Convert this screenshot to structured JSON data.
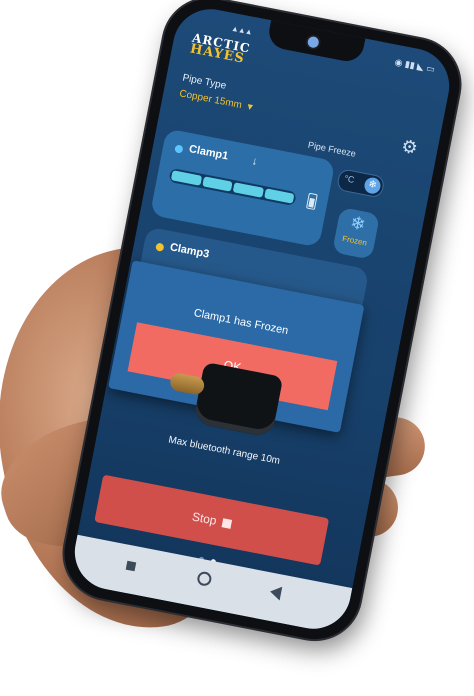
{
  "app": {
    "logo_line1": "ARCTIC",
    "logo_line2": "HAYES"
  },
  "header": {
    "pipe_type_label": "Pipe Type",
    "pipe_type_value": "Copper 15mm",
    "pipe_freeze_label": "Pipe Freeze",
    "unit_label": "°C",
    "settings_icon": "gear-icon"
  },
  "clamps": [
    {
      "name": "Clamp1",
      "indicator_color": "#5ec5ff",
      "progress_segments_filled": 4,
      "progress_segments_total": 4
    },
    {
      "name": "Clamp3",
      "indicator_color": "#f2c233"
    }
  ],
  "frozen_badge": {
    "label": "Frozen",
    "icon": "snowflake-icon"
  },
  "dialog": {
    "message": "Clamp1 has Frozen",
    "ok_label": "OK"
  },
  "device": {
    "caption": "Max bluetooth range 10m"
  },
  "actions": {
    "stop_label": "Stop"
  },
  "pager": {
    "pages": 2,
    "active_index": 1
  },
  "colors": {
    "accent_yellow": "#f2c233",
    "ok_red": "#f26b63",
    "stop_red": "#d14f4b",
    "bg_blue": "#1d4a78"
  }
}
